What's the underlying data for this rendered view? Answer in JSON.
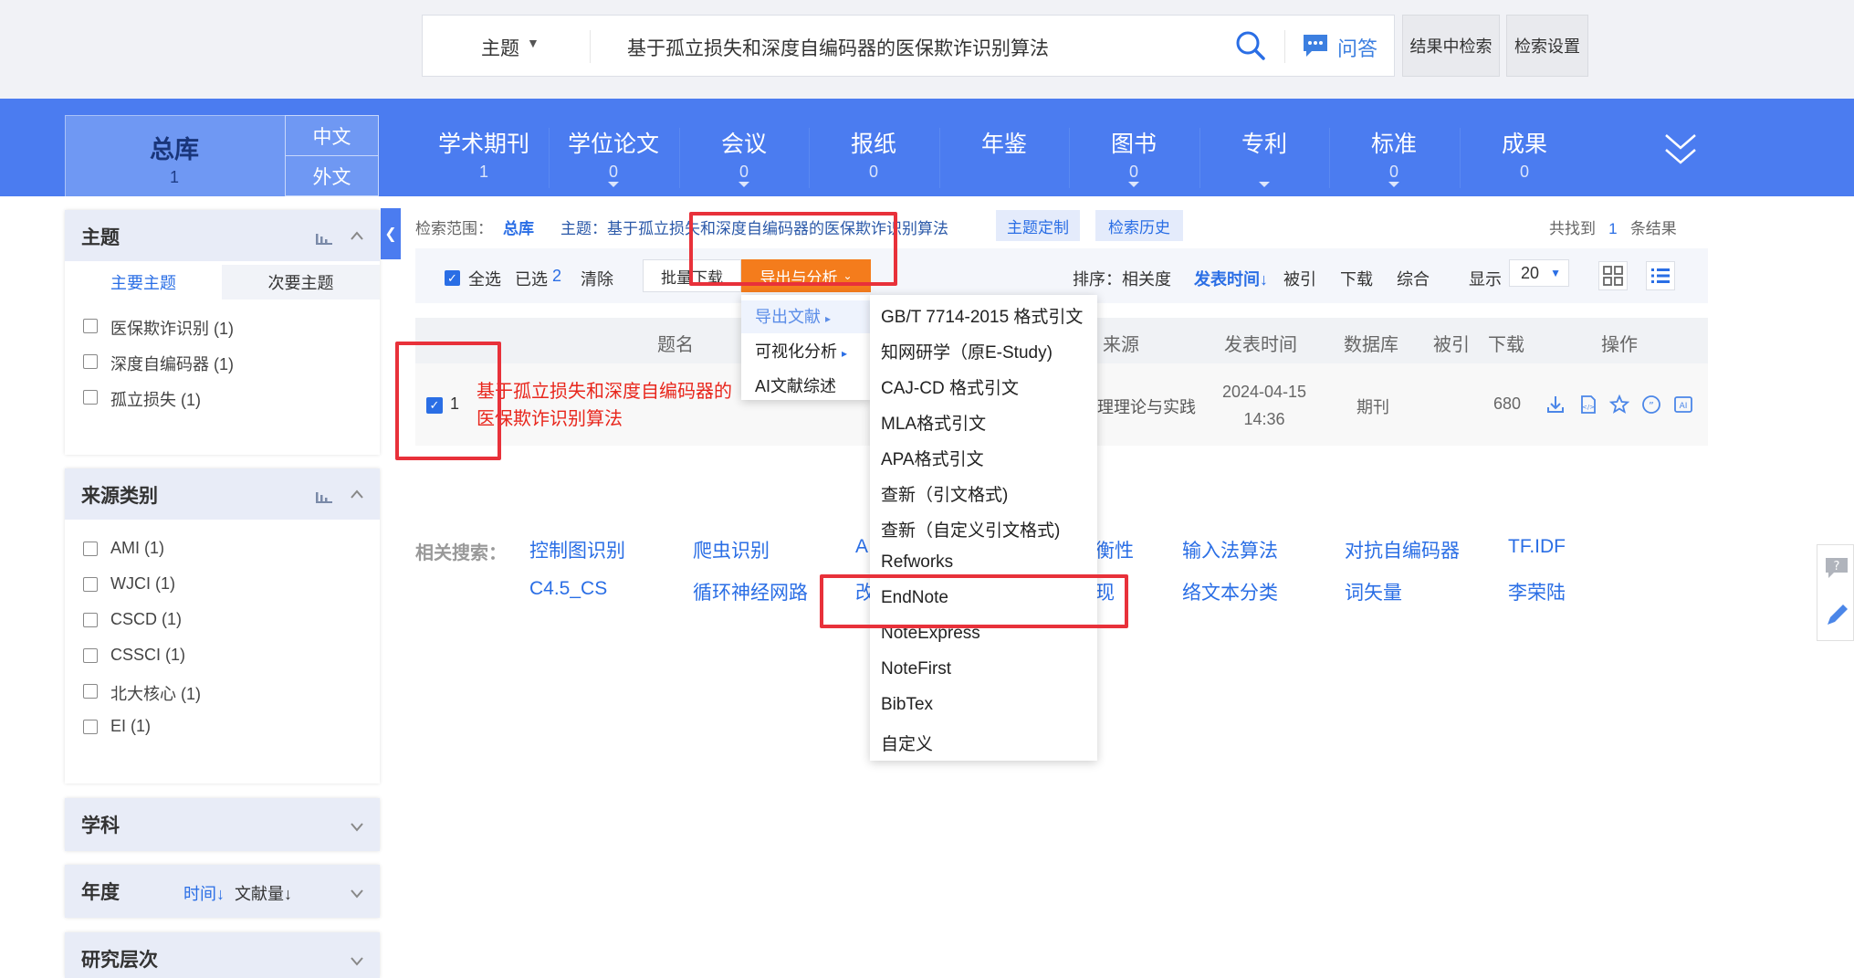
{
  "search": {
    "category": "主题",
    "query": "基于孤立损失和深度自编码器的医保欺诈识别算法",
    "qa_label": "问答",
    "in_result_label": "结果中检索",
    "settings_label": "检索设置"
  },
  "nav": {
    "total": {
      "label": "总库",
      "count": "1"
    },
    "lang_zh": "中文",
    "lang_en": "外文",
    "tabs": [
      {
        "label": "学术期刊",
        "count": "1"
      },
      {
        "label": "学位论文",
        "count": "0"
      },
      {
        "label": "会议",
        "count": "0"
      },
      {
        "label": "报纸",
        "count": "0"
      },
      {
        "label": "年鉴",
        "count": ""
      },
      {
        "label": "图书",
        "count": "0"
      },
      {
        "label": "专利",
        "count": ""
      },
      {
        "label": "标准",
        "count": "0"
      },
      {
        "label": "成果",
        "count": "0"
      }
    ]
  },
  "filters": {
    "topic": {
      "title": "主题",
      "tab_main": "主要主题",
      "tab_secondary": "次要主题",
      "items": [
        "医保欺诈识别 (1)",
        "深度自编码器 (1)",
        "孤立损失 (1)"
      ]
    },
    "source": {
      "title": "来源类别",
      "items": [
        "AMI (1)",
        "WJCI (1)",
        "CSCD (1)",
        "CSSCI (1)",
        "北大核心 (1)",
        "EI (1)"
      ]
    },
    "subject": {
      "title": "学科"
    },
    "year": {
      "title": "年度",
      "sort_time": "时间",
      "sort_count": "文献量"
    },
    "level": {
      "title": "研究层次"
    }
  },
  "crumbs": {
    "scope_label": "检索范围：",
    "scope_value": "总库",
    "topic_text": "主题：基于孤立损失和深度自编码器的医保欺诈识别算法",
    "custom_btn": "主题定制",
    "history_btn": "检索历史",
    "found_prefix": "共找到",
    "found_count": "1",
    "found_suffix": "条结果"
  },
  "toolbar": {
    "select_all": "全选",
    "selected_label": "已选",
    "selected_count": "2",
    "clear": "清除",
    "batch_download": "批量下载",
    "export_analysis": "导出与分析",
    "sort_label": "排序：",
    "sort_relevance": "相关度",
    "sort_time": "发表时间",
    "sort_cited": "被引",
    "sort_download": "下载",
    "sort_composite": "综合",
    "show_label": "显示",
    "page_size": "20"
  },
  "table": {
    "headers": {
      "title": "题名",
      "source": "来源",
      "date": "发表时间",
      "db": "数据库",
      "cited": "被引",
      "download": "下载",
      "ops": "操作"
    },
    "rows": [
      {
        "num": "1",
        "title": "基于孤立损失和深度自编码器的医保欺诈识别算法",
        "source": "理理论与实践",
        "date_line1": "2024-04-15",
        "date_line2": "14:36",
        "db": "期刊",
        "download": "680"
      }
    ]
  },
  "related": {
    "label": "相关搜索：",
    "row1": [
      "控制图识别",
      "爬虫识别",
      "A",
      "衡性",
      "输入法算法",
      "对抗自编码器",
      "TF.IDF"
    ],
    "row2": [
      "C4.5_CS",
      "循环神经网路",
      "改",
      "现",
      "络文本分类",
      "词矢量",
      "李荣陆"
    ]
  },
  "export_menu": {
    "items": [
      {
        "label": "导出文献",
        "arrow": "▸"
      },
      {
        "label": "可视化分析",
        "arrow": "▸"
      },
      {
        "label": "AI文献综述"
      }
    ],
    "formats": [
      "GB/T 7714-2015 格式引文",
      "知网研学（原E-Study)",
      "CAJ-CD 格式引文",
      "MLA格式引文",
      "APA格式引文",
      "查新（引文格式)",
      "查新（自定义引文格式)",
      "Refworks",
      "EndNote",
      "NoteExpress",
      "NoteFirst",
      "BibTex",
      "自定义"
    ]
  },
  "colors": {
    "nav_blue": "#4b7cf0",
    "accent": "#2a6ee5",
    "export_orange": "#f47c1c",
    "highlight_red": "#e8313a"
  }
}
